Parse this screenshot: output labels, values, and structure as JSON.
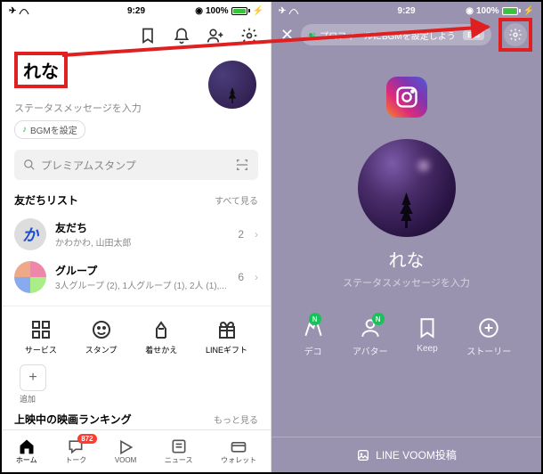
{
  "status": {
    "time": "9:29",
    "battery": "100%"
  },
  "left": {
    "name": "れな",
    "status_msg": "ステータスメッセージを入力",
    "bgm_set": "BGMを設定",
    "search_placeholder": "プレミアムスタンプ",
    "friends_title": "友だちリスト",
    "see_all": "すべて見る",
    "rows": [
      {
        "avatar_letter": "か",
        "name": "友だち",
        "sub": "かわかわ, 山田太郎",
        "count": "2"
      },
      {
        "avatar_letter": "",
        "name": "グループ",
        "sub": "3人グループ (2), 1人グループ (1), 2人 (1),...",
        "count": "6"
      }
    ],
    "grid": [
      {
        "label": "サービス"
      },
      {
        "label": "スタンプ"
      },
      {
        "label": "着せかえ"
      },
      {
        "label": "LINEギフト"
      }
    ],
    "add_label": "追加",
    "movie_title": "上映中の映画ランキング",
    "more": "もっと見る",
    "tabs": [
      {
        "label": "ホーム"
      },
      {
        "label": "トーク",
        "badge": "872"
      },
      {
        "label": "VOOM"
      },
      {
        "label": "ニュース"
      },
      {
        "label": "ウォレット"
      }
    ]
  },
  "right": {
    "bgm_prompt": "プロフィールにBGMを設定しよう",
    "bgm_end": "BIB",
    "name": "れな",
    "status_msg": "ステータスメッセージを入力",
    "grid": [
      {
        "label": "デコ",
        "badge": "N"
      },
      {
        "label": "アバター",
        "badge": "N"
      },
      {
        "label": "Keep"
      },
      {
        "label": "ストーリー"
      }
    ],
    "bottom": "LINE VOOM投稿"
  }
}
